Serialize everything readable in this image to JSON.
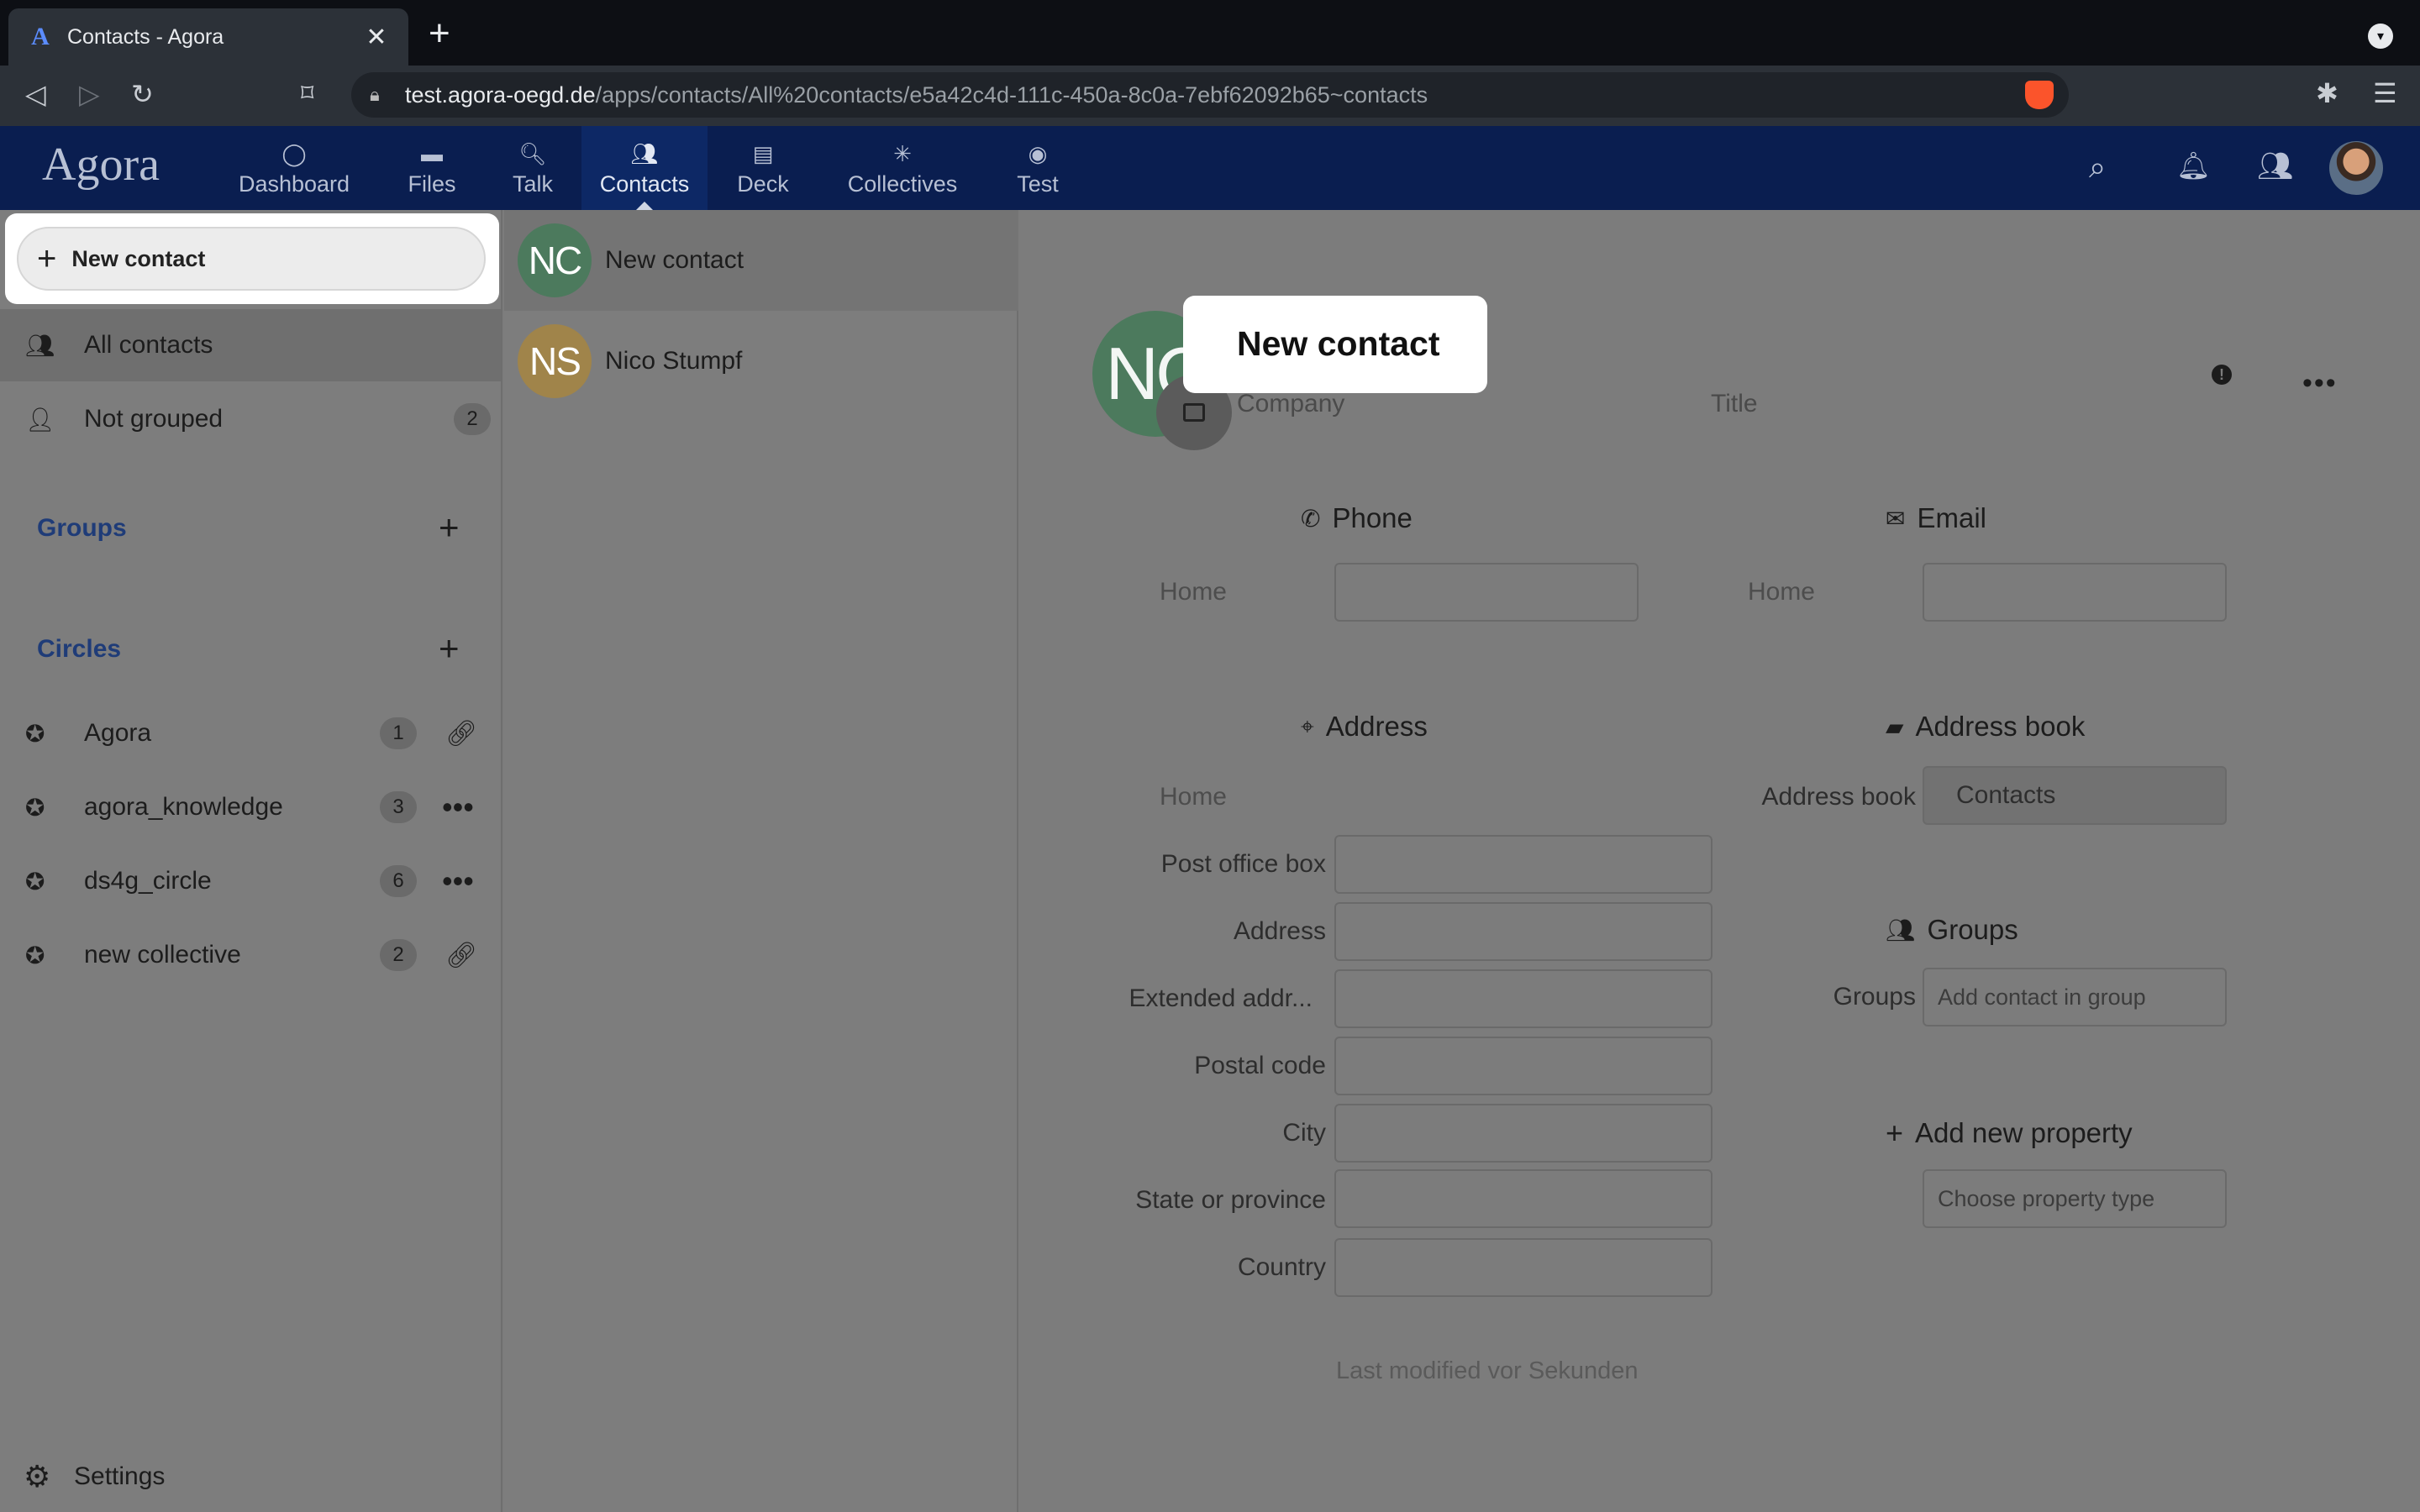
{
  "browser": {
    "tab_title": "Contacts - Agora",
    "tab_favicon": "A",
    "url_host": "test.agora-oegd.de",
    "url_path": "/apps/contacts/All%20contacts/e5a42c4d-111c-450a-8c0a-7ebf62092b65~contacts"
  },
  "app": {
    "logo": "Agora",
    "nav": [
      {
        "label": "Dashboard",
        "icon": "dashboard-icon"
      },
      {
        "label": "Files",
        "icon": "folder-icon"
      },
      {
        "label": "Talk",
        "icon": "talk-icon"
      },
      {
        "label": "Contacts",
        "icon": "contacts-icon",
        "active": true
      },
      {
        "label": "Deck",
        "icon": "deck-icon"
      },
      {
        "label": "Collectives",
        "icon": "collectives-icon"
      },
      {
        "label": "Test",
        "icon": "globe-icon"
      }
    ]
  },
  "sidebar": {
    "new_contact": "New contact",
    "all_contacts": "All contacts",
    "not_grouped": {
      "label": "Not grouped",
      "count": "2"
    },
    "groups_caption": "Groups",
    "circles_caption": "Circles",
    "circles": [
      {
        "label": "Agora",
        "count": "1",
        "action": "link-icon"
      },
      {
        "label": "agora_knowledge",
        "count": "3",
        "action": "more-icon"
      },
      {
        "label": "ds4g_circle",
        "count": "6",
        "action": "more-icon"
      },
      {
        "label": "new collective",
        "count": "2",
        "action": "link-icon"
      }
    ],
    "settings": "Settings"
  },
  "contact_list": [
    {
      "initials": "NC",
      "name": "New contact",
      "color": "#4c7a5d"
    },
    {
      "initials": "NS",
      "name": "Nico Stumpf",
      "color": "#a0844a"
    }
  ],
  "detail": {
    "initials": "NC",
    "name": "New contact",
    "company_placeholder": "Company",
    "title_placeholder": "Title",
    "phone": {
      "title": "Phone",
      "label": "Home"
    },
    "email": {
      "title": "Email",
      "label": "Home"
    },
    "address": {
      "title": "Address",
      "type_label": "Home",
      "fields": [
        "Post office box",
        "Address",
        "Extended addr...",
        "Postal code",
        "City",
        "State or province",
        "Country"
      ]
    },
    "addressbook": {
      "title": "Address book",
      "label": "Address book",
      "value": "Contacts"
    },
    "groups": {
      "title": "Groups",
      "label": "Groups",
      "placeholder": "Add contact in group"
    },
    "add_property": {
      "title": "Add new property",
      "placeholder": "Choose property type"
    },
    "last_modified": "Last modified vor Sekunden"
  }
}
